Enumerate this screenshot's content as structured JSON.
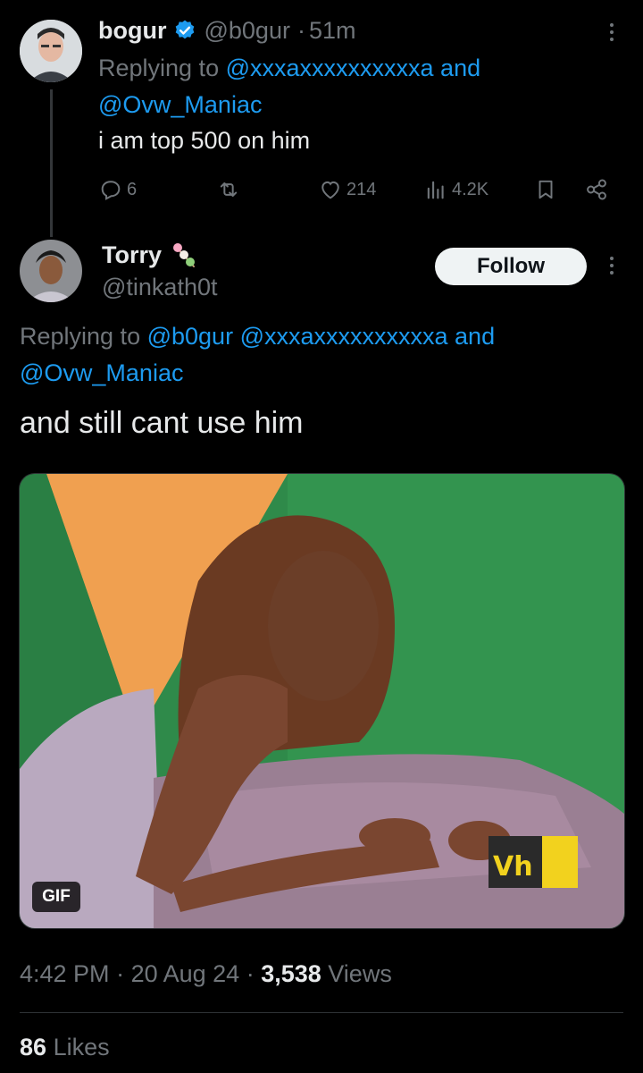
{
  "reply1": {
    "name": "bogur",
    "handle": "@b0gur",
    "time": "51m",
    "replying_prefix": "Replying to ",
    "mention1": "@xxxaxxxxxxxxxxa",
    "and": " and",
    "mention2": "@Ovw_Maniac",
    "text": "i am top 500 on him",
    "replies": "6",
    "reposts": "",
    "likes": "214",
    "views": "4.2K"
  },
  "main": {
    "name": "Torry",
    "handle": "@tinkath0t",
    "follow_label": "Follow",
    "replying_prefix": "Replying to ",
    "mention1": "@b0gur",
    "mention2": "@xxxaxxxxxxxxxxa",
    "and": " and",
    "mention3": "@Ovw_Maniac",
    "text": "and still cant use him",
    "gif_label": "GIF",
    "media_logo": "Vh",
    "time": "4:42 PM",
    "date": "20 Aug 24",
    "views_count": "3,538",
    "views_label": "Views",
    "likes_count": "86",
    "likes_label": "Likes"
  },
  "colors": {
    "background": "#000000",
    "accent": "#1d9bf0",
    "muted": "#71767b",
    "verified": "#1d9bf0"
  }
}
